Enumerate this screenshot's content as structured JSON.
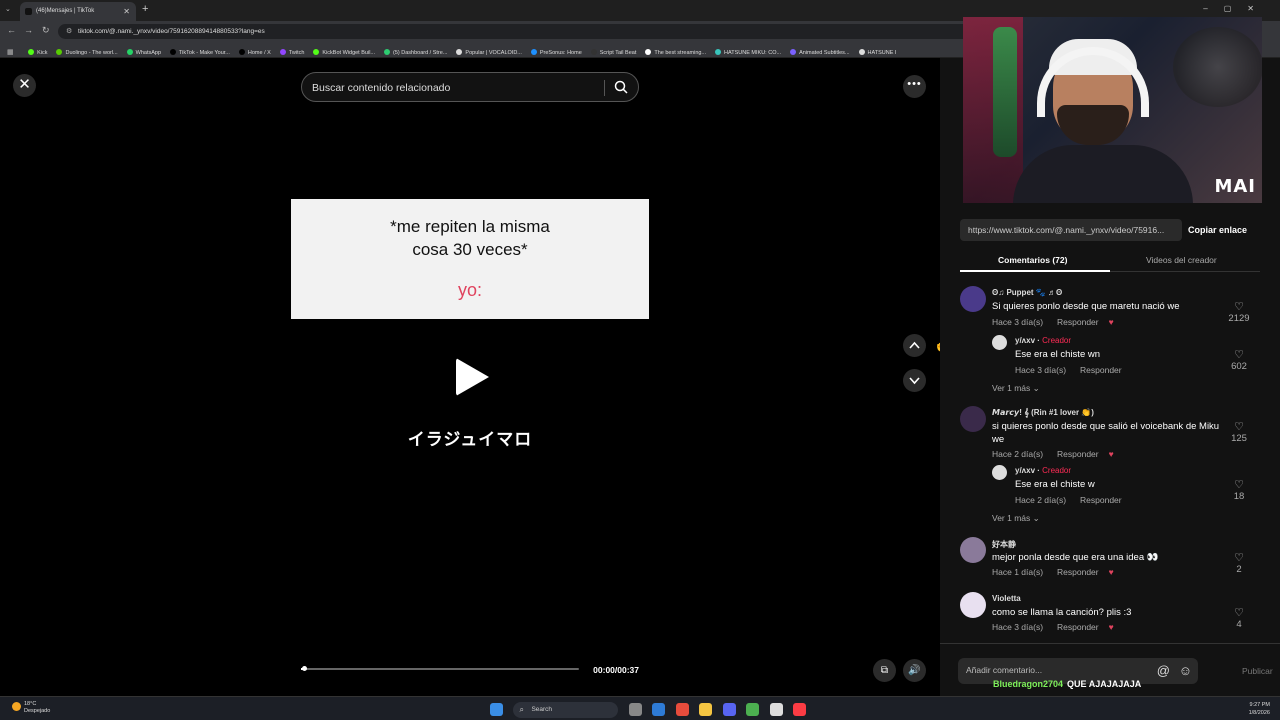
{
  "browser": {
    "tab_title": "(46)Mensajes | TikTok",
    "url": "tiktok.com/@.nami._ynxv/video/7591620889414880533?lang=es",
    "bookmarks": [
      {
        "label": "Kick",
        "color": "#53fc18"
      },
      {
        "label": "Duolingo - The worl...",
        "color": "#58cc02"
      },
      {
        "label": "WhatsApp",
        "color": "#25d366"
      },
      {
        "label": "TikTok - Make Your...",
        "color": "#000000"
      },
      {
        "label": "Home / X",
        "color": "#000000"
      },
      {
        "label": "Twitch",
        "color": "#9146ff"
      },
      {
        "label": "KickBot Widget Buil...",
        "color": "#53fc18"
      },
      {
        "label": "(5) Dashboard / Stre...",
        "color": "#2ecc71"
      },
      {
        "label": "Popular | VOCALOID...",
        "color": "#dddddd"
      },
      {
        "label": "PreSonus: Home",
        "color": "#1e90ff"
      },
      {
        "label": "Script Tail Beat",
        "color": "#333333"
      },
      {
        "label": "The best streaming...",
        "color": "#ffffff"
      },
      {
        "label": "HATSUNE MIKU: CO...",
        "color": "#39c5bb"
      },
      {
        "label": "Animated Subtitles...",
        "color": "#7b61ff"
      },
      {
        "label": "HATSUNE I",
        "color": "#dddddd"
      }
    ]
  },
  "video": {
    "search_placeholder": "Buscar contenido relacionado",
    "caption_line1": "*me repiten la misma",
    "caption_line2": "cosa 30 veces*",
    "caption_yo": "yo:",
    "overlay_text": "イラジュイマロ",
    "time": "00:00/00:37",
    "progress": 0.01
  },
  "panel": {
    "webcam_label": "MAI",
    "link_url": "https://www.tiktok.com/@.nami._ynxv/video/75916...",
    "copy_label": "Copiar enlace",
    "tab_comments": "Comentarios (72)",
    "tab_creator_videos": "Videos del creador",
    "reply_label": "Responder",
    "see_more": "Ver 1 más",
    "creator_label": "Creador",
    "comments": [
      {
        "user": "ʘ♫ Puppet 🐾 ♬ʘ",
        "text": "Si quieres ponlo desde que maretu nació we",
        "time": "Hace 3 día(s)",
        "likes": "2129",
        "avatar_color": "#4a3a8a",
        "reply": {
          "user": "y/ʌxv",
          "text": "Ese era el chiste wn",
          "time": "Hace 3 día(s)",
          "likes": "602"
        }
      },
      {
        "user": "𝙈𝙖𝙧𝙘𝙮! 𝄞 (Rin #1 lover 👏)",
        "text": "si quieres ponlo desde que salió el voicebank de Miku we",
        "time": "Hace 2 día(s)",
        "likes": "125",
        "avatar_color": "#3a2a4a",
        "reply": {
          "user": "y/ʌxv",
          "text": "Ese era el chiste w",
          "time": "Hace 2 día(s)",
          "likes": "18"
        }
      },
      {
        "user": "好本静",
        "text": "mejor ponla desde que era una idea 👀",
        "time": "Hace 1 día(s)",
        "likes": "2",
        "avatar_color": "#8a7a9a"
      },
      {
        "user": "Violetta",
        "text": "como se llama la canción? plis :3",
        "time": "Hace 3 día(s)",
        "likes": "4",
        "avatar_color": "#e8e0f0"
      }
    ],
    "comment_placeholder": "Añadir comentario...",
    "publish_label": "Publicar"
  },
  "chat_overlay": {
    "user": "Bluedragon2704",
    "message": "QUE AJAJAJAJA"
  },
  "taskbar": {
    "weather_temp": "18°C",
    "weather_desc": "Despejado",
    "search_label": "Search",
    "time": "9:27 PM",
    "date": "1/8/2026"
  }
}
